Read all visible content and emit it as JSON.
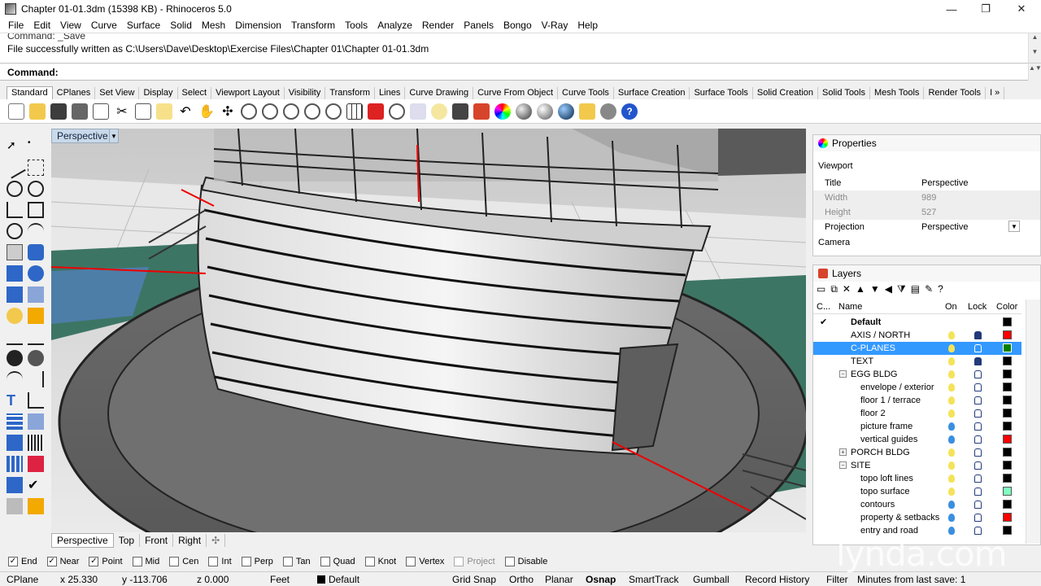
{
  "window": {
    "title": "Chapter 01-01.3dm (15398 KB) - Rhinoceros 5.0",
    "minimize": "—",
    "maximize": "❐",
    "close": "✕"
  },
  "menu": [
    "File",
    "Edit",
    "View",
    "Curve",
    "Surface",
    "Solid",
    "Mesh",
    "Dimension",
    "Transform",
    "Tools",
    "Analyze",
    "Render",
    "Panels",
    "Bongo",
    "V-Ray",
    "Help"
  ],
  "command_history": {
    "line1": "Command: _Save",
    "line2": "File successfully written as C:\\Users\\Dave\\Desktop\\Exercise Files\\Chapter 01\\Chapter 01-01.3dm"
  },
  "command_prompt": "Command:",
  "toolbar_tabs": [
    "Standard",
    "CPlanes",
    "Set View",
    "Display",
    "Select",
    "Viewport Layout",
    "Visibility",
    "Transform",
    "Lines",
    "Curve Drawing",
    "Curve From Object",
    "Curve Tools",
    "Surface Creation",
    "Surface Tools",
    "Solid Creation",
    "Solid Tools",
    "Mesh Tools",
    "Render Tools"
  ],
  "toolbar_more": "I »",
  "viewport": {
    "label": "Perspective",
    "tabs": [
      "Perspective",
      "Top",
      "Front",
      "Right"
    ],
    "add_tab": "✣"
  },
  "properties": {
    "header": "Properties",
    "section": "Viewport",
    "rows": [
      {
        "key": "Title",
        "value": "Perspective"
      },
      {
        "key": "Width",
        "value": "989"
      },
      {
        "key": "Height",
        "value": "527"
      },
      {
        "key": "Projection",
        "value": "Perspective"
      }
    ],
    "camera": "Camera"
  },
  "layers": {
    "header": "Layers",
    "columns": {
      "current": "C...",
      "name": "Name",
      "on": "On",
      "lock": "Lock",
      "color": "Color"
    },
    "current_mark": "✔",
    "rows": [
      {
        "name": "Default",
        "color": "#000000"
      },
      {
        "name": "AXIS / NORTH",
        "color": "#ff0000"
      },
      {
        "name": "C-PLANES",
        "color": "#008000"
      },
      {
        "name": "TEXT",
        "color": "#000000"
      },
      {
        "name": "EGG BLDG",
        "color": "#000000"
      },
      {
        "name": "envelope / exterior",
        "color": "#000000"
      },
      {
        "name": "floor 1 / terrace",
        "color": "#000000"
      },
      {
        "name": "floor 2",
        "color": "#000000"
      },
      {
        "name": "picture frame",
        "color": "#000000"
      },
      {
        "name": "vertical guides",
        "color": "#ff0000"
      },
      {
        "name": "PORCH BLDG",
        "color": "#000000"
      },
      {
        "name": "SITE",
        "color": "#000000"
      },
      {
        "name": "topo loft lines",
        "color": "#000000"
      },
      {
        "name": "topo surface",
        "color": "#80ffc0"
      },
      {
        "name": "contours",
        "color": "#000000"
      },
      {
        "name": "property & setbacks",
        "color": "#ff0000"
      },
      {
        "name": "entry and road",
        "color": "#000000"
      }
    ]
  },
  "osnaps": [
    {
      "label": "End",
      "checked": true
    },
    {
      "label": "Near",
      "checked": true
    },
    {
      "label": "Point",
      "checked": true
    },
    {
      "label": "Mid",
      "checked": false
    },
    {
      "label": "Cen",
      "checked": false
    },
    {
      "label": "Int",
      "checked": false
    },
    {
      "label": "Perp",
      "checked": false
    },
    {
      "label": "Tan",
      "checked": false
    },
    {
      "label": "Quad",
      "checked": false
    },
    {
      "label": "Knot",
      "checked": false
    },
    {
      "label": "Vertex",
      "checked": false
    },
    {
      "label": "Project",
      "checked": false
    },
    {
      "label": "Disable",
      "checked": false
    }
  ],
  "status": {
    "cplane": "CPlane",
    "x": "x 25.330",
    "y": "y -113.706",
    "z": "z 0.000",
    "units": "Feet",
    "layer": "Default",
    "grid_snap": "Grid Snap",
    "ortho": "Ortho",
    "planar": "Planar",
    "osnap": "Osnap",
    "smarttrack": "SmartTrack",
    "gumball": "Gumball",
    "record_history": "Record History",
    "filter": "Filter",
    "save_info": "Minutes from last save: 1"
  },
  "watermark": "lynda.com"
}
